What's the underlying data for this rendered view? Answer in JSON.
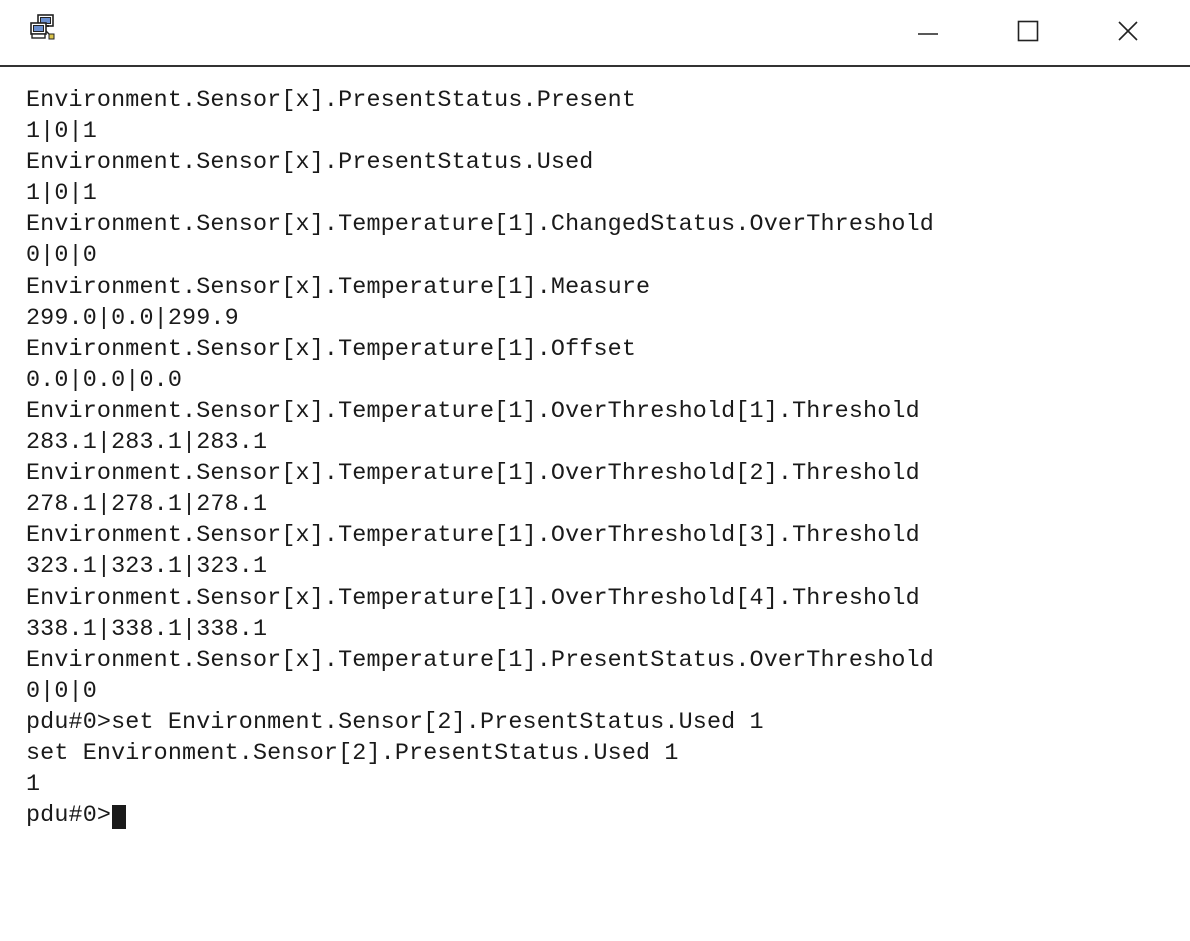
{
  "window": {
    "minimize_label": "",
    "maximize_label": "",
    "close_label": ""
  },
  "terminal": {
    "lines": [
      "Environment.Sensor[x].PresentStatus.Present",
      "1|0|1",
      "Environment.Sensor[x].PresentStatus.Used",
      "1|0|1",
      "Environment.Sensor[x].Temperature[1].ChangedStatus.OverThreshold",
      "0|0|0",
      "Environment.Sensor[x].Temperature[1].Measure",
      "299.0|0.0|299.9",
      "Environment.Sensor[x].Temperature[1].Offset",
      "0.0|0.0|0.0",
      "Environment.Sensor[x].Temperature[1].OverThreshold[1].Threshold",
      "283.1|283.1|283.1",
      "Environment.Sensor[x].Temperature[1].OverThreshold[2].Threshold",
      "278.1|278.1|278.1",
      "Environment.Sensor[x].Temperature[1].OverThreshold[3].Threshold",
      "323.1|323.1|323.1",
      "Environment.Sensor[x].Temperature[1].OverThreshold[4].Threshold",
      "338.1|338.1|338.1",
      "Environment.Sensor[x].Temperature[1].PresentStatus.OverThreshold",
      "0|0|0",
      "pdu#0>set Environment.Sensor[2].PresentStatus.Used 1",
      "set Environment.Sensor[2].PresentStatus.Used 1",
      "1"
    ],
    "prompt": "pdu#0>"
  },
  "icons": {
    "app": "terminal-app-icon",
    "minimize": "minimize-icon",
    "maximize": "maximize-icon",
    "close": "close-icon"
  }
}
